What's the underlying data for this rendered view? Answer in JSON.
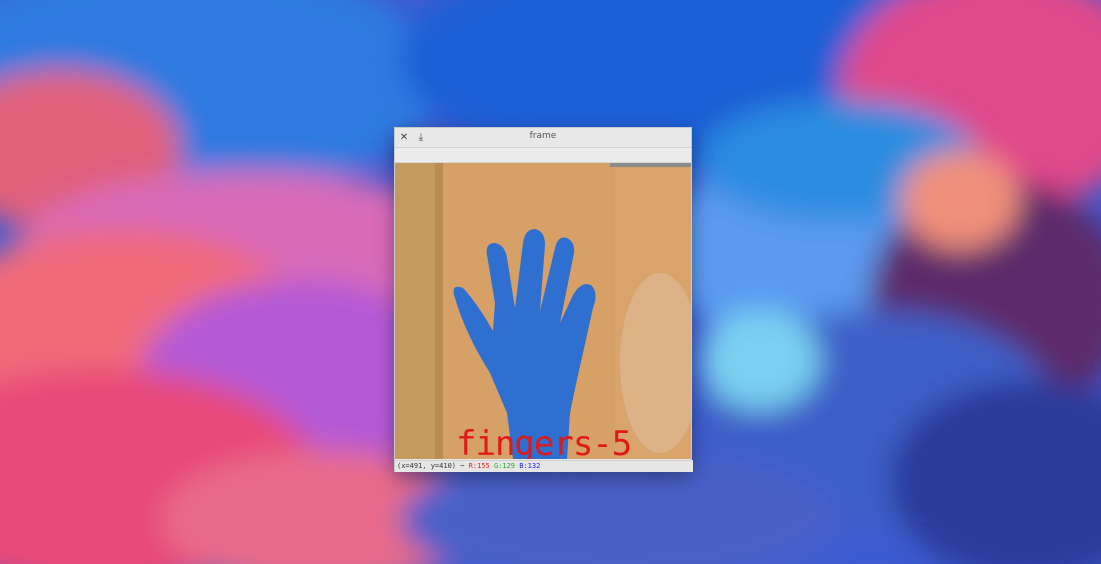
{
  "window": {
    "title": "frame",
    "close_icon": "close-icon",
    "save_icon": "save-download-icon"
  },
  "frame": {
    "overlay_text": "fingers-5",
    "overlay_color": "#e01818"
  },
  "status": {
    "coords": "(x=491, y=410) ~",
    "r": "R:155",
    "g": "G:129",
    "b": "B:132"
  },
  "colors": {
    "glove": "#2f6fd0",
    "wall": "#d7a266"
  }
}
